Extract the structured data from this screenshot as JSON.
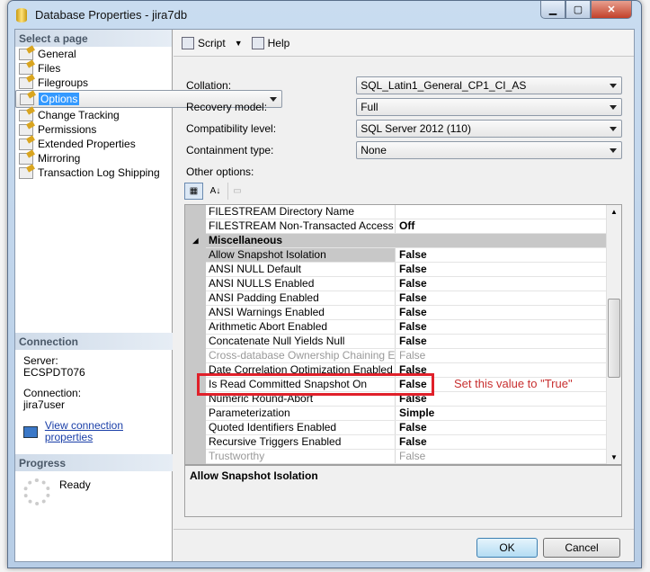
{
  "window": {
    "title": "Database Properties - jira7db"
  },
  "left": {
    "select_header": "Select a page",
    "pages": [
      "General",
      "Files",
      "Filegroups",
      "Options",
      "Change Tracking",
      "Permissions",
      "Extended Properties",
      "Mirroring",
      "Transaction Log Shipping"
    ],
    "selected": "Options",
    "connection": {
      "header": "Connection",
      "server_label": "Server:",
      "server": "ECSPDT076",
      "connection_label": "Connection:",
      "connection": "jira7user",
      "link": "View connection properties"
    },
    "progress": {
      "header": "Progress",
      "status": "Ready"
    }
  },
  "toolbar": {
    "script": "Script",
    "help": "Help"
  },
  "form": {
    "collation_label": "Collation:",
    "collation": "SQL_Latin1_General_CP1_CI_AS",
    "recovery_label": "Recovery model:",
    "recovery": "Full",
    "compat_label": "Compatibility level:",
    "compat": "SQL Server 2012 (110)",
    "containment_label": "Containment type:",
    "containment": "None",
    "other_label": "Other options:"
  },
  "grid": {
    "rows": [
      {
        "k": "FILESTREAM Directory Name",
        "v": ""
      },
      {
        "k": "FILESTREAM Non-Transacted Access",
        "v": "Off"
      },
      {
        "k": "Miscellaneous",
        "v": "",
        "category": true
      },
      {
        "k": "Allow Snapshot Isolation",
        "v": "False",
        "selected": true
      },
      {
        "k": "ANSI NULL Default",
        "v": "False"
      },
      {
        "k": "ANSI NULLS Enabled",
        "v": "False"
      },
      {
        "k": "ANSI Padding Enabled",
        "v": "False"
      },
      {
        "k": "ANSI Warnings Enabled",
        "v": "False"
      },
      {
        "k": "Arithmetic Abort Enabled",
        "v": "False"
      },
      {
        "k": "Concatenate Null Yields Null",
        "v": "False"
      },
      {
        "k": "Cross-database Ownership Chaining Enabled",
        "v": "False",
        "disabled": true
      },
      {
        "k": "Date Correlation Optimization Enabled",
        "v": "False"
      },
      {
        "k": "Is Read Committed Snapshot On",
        "v": "False"
      },
      {
        "k": "Numeric Round-Abort",
        "v": "False"
      },
      {
        "k": "Parameterization",
        "v": "Simple"
      },
      {
        "k": "Quoted Identifiers Enabled",
        "v": "False"
      },
      {
        "k": "Recursive Triggers Enabled",
        "v": "False"
      },
      {
        "k": "Trustworthy",
        "v": "False",
        "disabled": true
      }
    ]
  },
  "description": "Allow Snapshot Isolation",
  "annotation": "Set this value to \"True\"",
  "buttons": {
    "ok": "OK",
    "cancel": "Cancel"
  },
  "colors": {
    "annotation": "#e0202a",
    "selection": "#3399ff"
  }
}
